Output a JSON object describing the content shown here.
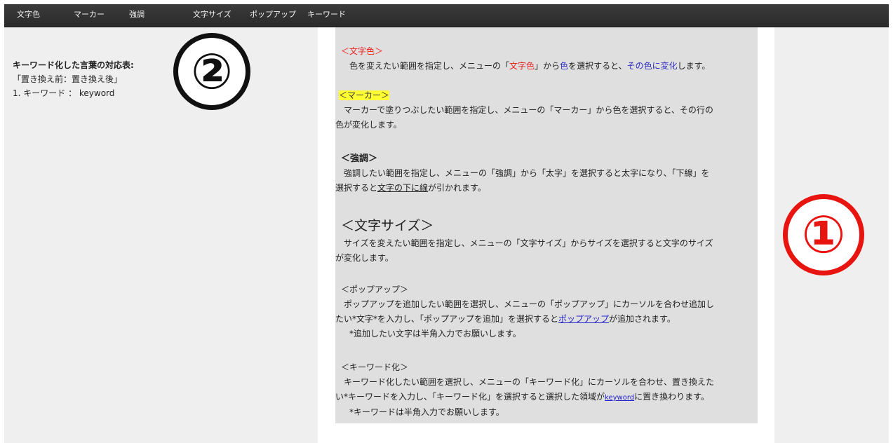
{
  "menubar": {
    "items": [
      "文字色",
      "マーカー",
      "強調",
      "文字サイズ",
      "ポップアップ",
      "キーワード"
    ]
  },
  "keyword_panel": {
    "title": "キーワード化した言葉の対応表:",
    "format": "「置き換え前：置き換え後」",
    "entry1": "1. キーワード ： keyword"
  },
  "annotations": {
    "circle1": "①",
    "circle2": "②"
  },
  "content": {
    "color": {
      "heading": "＜文字色＞",
      "t1": "　色を変えたい範囲を指定し、メニューの「",
      "red": "文字色",
      "t2": "」から",
      "blue1": "色",
      "t3": "を選択すると、",
      "blue2": "その色に変化",
      "t4": "します。"
    },
    "marker": {
      "heading": "＜マーカー＞",
      "line1": "　マーカーで塗りつぶしたい範囲を指定し、メニューの「マーカー」から色を選択すると、その行の",
      "line2": "色が変化します。"
    },
    "emphasis": {
      "heading": "＜強調＞",
      "line1": "　強調したい範囲を指定し、メニューの「強調」から「太字」を選択すると太字になり、「下線」を",
      "l2a": "選択すると",
      "l2u": "文字の下に線",
      "l2b": "が引かれます。"
    },
    "size": {
      "heading": "＜文字サイズ＞",
      "line1": "　サイズを変えたい範囲を指定し、メニューの「文字サイズ」からサイズを選択すると文字のサイズ",
      "line2": "が変化します。"
    },
    "popup": {
      "heading": "＜ポップアップ＞",
      "line1": "　ポップアップを追加したい範囲を選択し、メニューの「ポップアップ」にカーソルを合わせ追加し",
      "l2a": "たい*文字*を入力し、「ポップアップを追加」を選択すると",
      "l2link": "ポップアップ",
      "l2b": "が追加されます。",
      "note": "　*追加したい文字は半角入力でお願いします。"
    },
    "keyword": {
      "heading": "＜キーワード化＞",
      "line1": "　キーワード化したい範囲を選択し、メニューの「キーワード化」にカーソルを合わせ、置き換えた",
      "l2a": "い*キーワードを入力し、「キーワード化」を選択すると選択した領域が",
      "l2link": "keyword",
      "l2b": "に置き換わります。",
      "note": "　*キーワードは半角入力でお願いします。"
    }
  }
}
